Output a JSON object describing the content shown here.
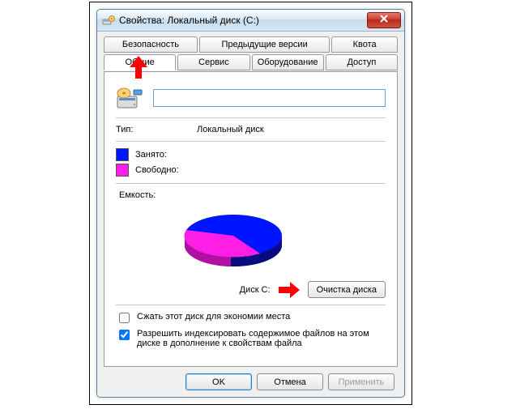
{
  "window": {
    "title": "Свойства: Локальный диск (C:)"
  },
  "tabs_row1": [
    {
      "label": "Безопасность"
    },
    {
      "label": "Предыдущие версии"
    },
    {
      "label": "Квота"
    }
  ],
  "tabs_row2": [
    {
      "label": "Общие",
      "active": true
    },
    {
      "label": "Сервис"
    },
    {
      "label": "Оборудование"
    },
    {
      "label": "Доступ"
    }
  ],
  "general": {
    "name_value": "",
    "type_label": "Тип:",
    "type_value": "Локальный диск",
    "legend_used": "Занято:",
    "legend_free": "Свободно:",
    "capacity_label": "Емкость:",
    "disk_label": "Диск C:",
    "cleanup_button": "Очистка диска",
    "compress_label": "Сжать этот диск для экономии места",
    "index_label": "Разрешить индексировать содержимое файлов на этом диске в дополнение к свойствам файла",
    "compress_checked": false,
    "index_checked": true
  },
  "colors": {
    "used": "#0015ff",
    "free": "#ff1ee6"
  },
  "buttons": {
    "ok": "OK",
    "cancel": "Отмена",
    "apply": "Применить"
  },
  "chart_data": {
    "type": "pie",
    "title": "",
    "series": [
      {
        "name": "Занято",
        "value": 55,
        "color": "#0015ff"
      },
      {
        "name": "Свободно",
        "value": 45,
        "color": "#ff1ee6"
      }
    ]
  }
}
